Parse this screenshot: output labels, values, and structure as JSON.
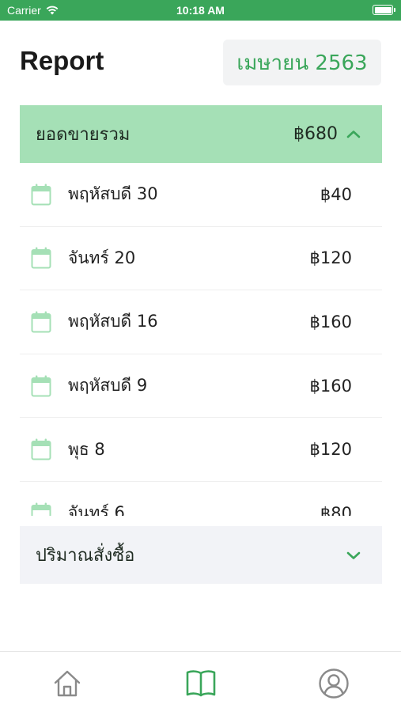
{
  "status_bar": {
    "carrier": "Carrier",
    "time": "10:18 AM"
  },
  "header": {
    "title": "Report",
    "month_label": "เมษายน 2563"
  },
  "sales_section": {
    "title": "ยอดขายรวม",
    "total": "฿680",
    "expanded": true,
    "rows": [
      {
        "day": "พฤหัสบดี 30",
        "amount": "฿40"
      },
      {
        "day": "จันทร์ 20",
        "amount": "฿120"
      },
      {
        "day": "พฤหัสบดี 16",
        "amount": "฿160"
      },
      {
        "day": "พฤหัสบดี 9",
        "amount": "฿160"
      },
      {
        "day": "พุธ 8",
        "amount": "฿120"
      },
      {
        "day": "จันทร์ 6",
        "amount": "฿80"
      }
    ]
  },
  "order_section": {
    "title": "ปริมาณสั่งซื้อ",
    "expanded": false
  },
  "tab_bar": {
    "tabs": [
      {
        "icon": "home-icon",
        "active": false
      },
      {
        "icon": "book-icon",
        "active": true
      },
      {
        "icon": "profile-icon",
        "active": false
      }
    ]
  },
  "colors": {
    "accent": "#3aa65a",
    "section_header_bg": "#a5e0b6",
    "calendar_icon": "#a5e0b6",
    "inactive_icon": "#8a8a8a"
  }
}
